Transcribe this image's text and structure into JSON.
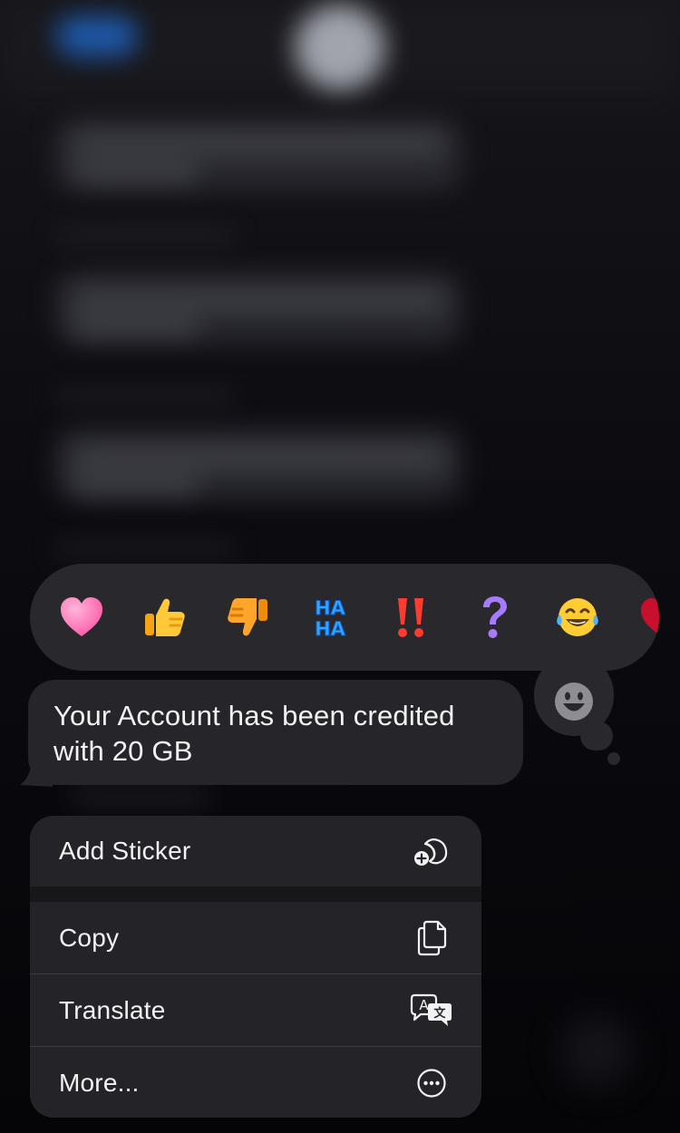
{
  "message": {
    "text": "Your Account has been credited with 20 GB"
  },
  "tapbacks": [
    {
      "name": "heart",
      "icon": "heart-icon"
    },
    {
      "name": "thumbs-up",
      "icon": "thumbs-up-icon"
    },
    {
      "name": "thumbs-down",
      "icon": "thumbs-down-icon"
    },
    {
      "name": "haha",
      "icon": "haha-icon",
      "text": "HA HA"
    },
    {
      "name": "exclamation",
      "icon": "double-exclamation-icon"
    },
    {
      "name": "question",
      "icon": "question-mark-icon"
    },
    {
      "name": "laughing",
      "icon": "tears-of-joy-icon"
    },
    {
      "name": "more-emoji",
      "icon": "red-heart-icon"
    }
  ],
  "emoji_picker": {
    "icon": "smiley-icon"
  },
  "menu": {
    "add_sticker": {
      "label": "Add Sticker",
      "icon": "sticker-add-icon"
    },
    "copy": {
      "label": "Copy",
      "icon": "copy-icon"
    },
    "translate": {
      "label": "Translate",
      "icon": "translate-icon"
    },
    "more": {
      "label": "More...",
      "icon": "ellipsis-circle-icon"
    }
  },
  "colors": {
    "menu_bg": "#242428",
    "bubble_bg": "#26262a",
    "tapback_bg": "#29292d",
    "text": "#f2f2f5"
  }
}
